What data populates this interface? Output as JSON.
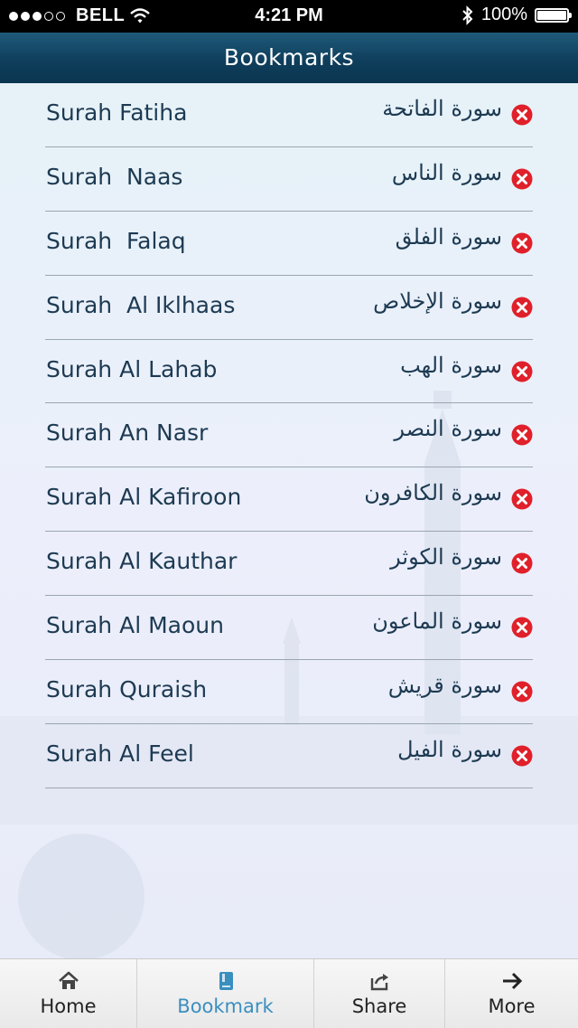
{
  "status_bar": {
    "carrier": "BELL",
    "time": "4:21 PM",
    "battery": "100%"
  },
  "nav": {
    "title": "Bookmarks"
  },
  "bookmarks": [
    {
      "english": "Surah Fatiha",
      "arabic": "سورة الفاتحة"
    },
    {
      "english": "Surah  Naas",
      "arabic": "سورة الناس"
    },
    {
      "english": "Surah  Falaq",
      "arabic": "سورة الفلق"
    },
    {
      "english": "Surah  Al Iklhaas",
      "arabic": "سورة الإخلاص"
    },
    {
      "english": "Surah Al Lahab",
      "arabic": "سورة الهب"
    },
    {
      "english": "Surah An Nasr",
      "arabic": "سورة النصر"
    },
    {
      "english": "Surah Al Kafiroon",
      "arabic": "سورة الكافرون"
    },
    {
      "english": "Surah Al Kauthar",
      "arabic": "سورة الكوثر"
    },
    {
      "english": "Surah Al Maoun",
      "arabic": "سورة الماعون"
    },
    {
      "english": "Surah Quraish",
      "arabic": "سورة قريش"
    },
    {
      "english": "Surah Al Feel",
      "arabic": "سورة الفيل"
    }
  ],
  "tab_bar": {
    "tabs": [
      {
        "label": "Home",
        "icon": "home-icon"
      },
      {
        "label": "Bookmark",
        "icon": "bookmark-icon",
        "active": true
      },
      {
        "label": "Share",
        "icon": "share-icon"
      },
      {
        "label": "More",
        "icon": "arrow-right-icon"
      }
    ]
  },
  "colors": {
    "nav_bar": "#0f3f5c",
    "text": "#1d3a52",
    "delete": "#e0202a",
    "active_tab": "#3a8fbf"
  }
}
